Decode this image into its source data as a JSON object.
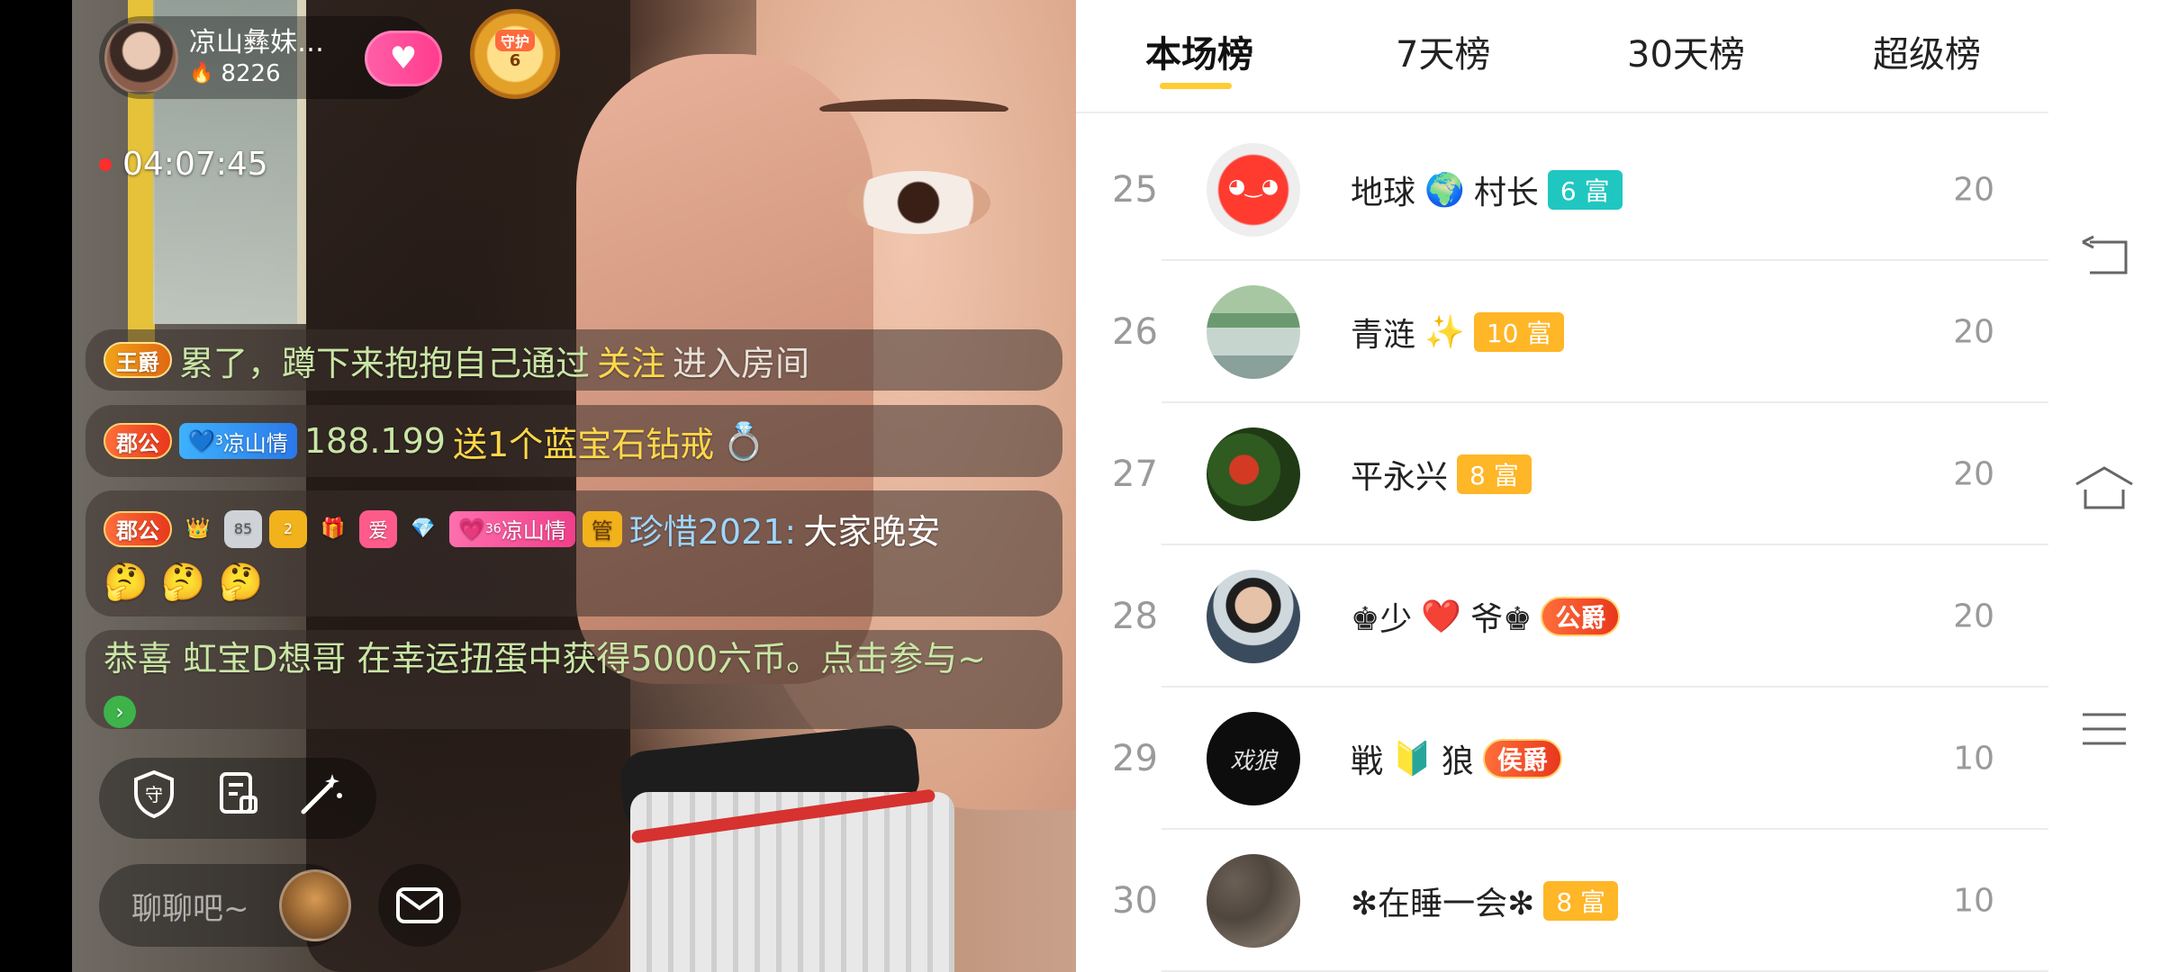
{
  "anchor": {
    "name": "凉山彝妹…",
    "heat": "8226",
    "guard_label": "守护",
    "guard_level": "6"
  },
  "stream": {
    "elapsed_time": "04:07:45"
  },
  "chat": {
    "msg1": {
      "badge": "王爵",
      "user": "累了，蹲下来抱抱自己通过",
      "action": "关注",
      "tail": "进入房间"
    },
    "msg2": {
      "badge": "郡公",
      "fan_level": "3",
      "fan_club": "凉山情",
      "user": "188.199",
      "gift": "送1个蓝宝石钻戒"
    },
    "msg3": {
      "badge": "郡公",
      "badge_num": "85",
      "star_num": "2",
      "love_badge": "爱",
      "fan_level": "36",
      "fan_club": "凉山情",
      "manager_badge": "管",
      "user": "珍惜2021:",
      "text": "大家晚安",
      "emojis": [
        "🤔",
        "🤔",
        "🤔"
      ]
    },
    "msg4": {
      "text": "恭喜 虹宝D想哥 在幸运扭蛋中获得5000六币。点击参与~"
    }
  },
  "toolbar": {
    "icons": [
      "shield-guard-icon",
      "task-icon",
      "magic-wand-icon"
    ],
    "input_placeholder": "聊聊吧~"
  },
  "ranking": {
    "tabs": [
      "本场榜",
      "7天榜",
      "30天榜",
      "超级榜"
    ],
    "active_tab": 0,
    "rows": [
      {
        "rank": "25",
        "name_parts": [
          "地球",
          "🌍",
          "村长"
        ],
        "tag": "6 富",
        "tag_style": "teal",
        "score": "20"
      },
      {
        "rank": "26",
        "name_parts": [
          "青涟",
          "✨"
        ],
        "tag": "10 富",
        "tag_style": "amber",
        "score": "20"
      },
      {
        "rank": "27",
        "name_parts": [
          "平永兴"
        ],
        "tag": "8 富",
        "tag_style": "amber",
        "score": "20"
      },
      {
        "rank": "28",
        "name_parts": [
          "♚少",
          "❤️",
          "爷♚"
        ],
        "tag": "公爵",
        "tag_style": "duke",
        "score": "20"
      },
      {
        "rank": "29",
        "name_parts": [
          "戦",
          "🔰",
          "狼"
        ],
        "tag": "侯爵",
        "tag_style": "duke",
        "score": "10",
        "avatar_text": "戏狼"
      },
      {
        "rank": "30",
        "name_parts": [
          "✻在睡一会✻"
        ],
        "tag": "8 富",
        "tag_style": "amber",
        "score": "10"
      }
    ]
  },
  "colors": {
    "tab_indicator": "#ffcc33",
    "tag_teal": "#1fc7c0",
    "tag_amber": "#ffb627",
    "chat_highlight": "#ffd84a"
  }
}
